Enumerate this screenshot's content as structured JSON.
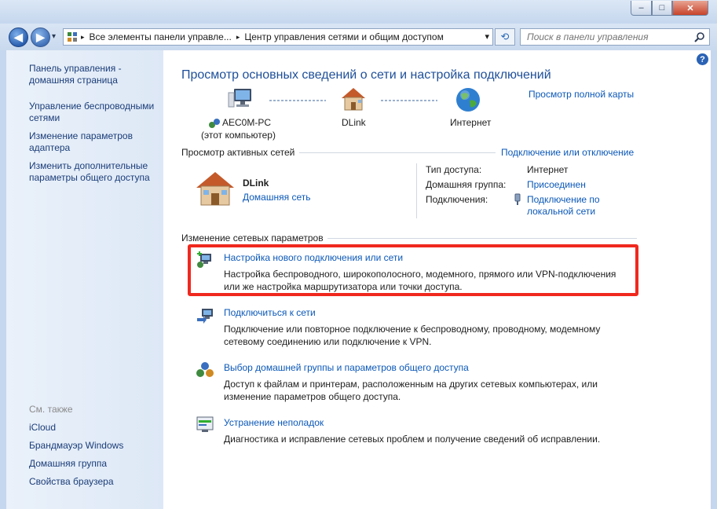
{
  "window": {
    "min_glyph": "–",
    "max_glyph": "□",
    "close_glyph": "✕"
  },
  "address": {
    "root_icon": "control-panel-icon",
    "crumb1": "Все элементы панели управле...",
    "sep": "▸",
    "crumb2": "Центр управления сетями и общим доступом",
    "dropdown_glyph": "▾",
    "refresh_glyph": "⟲"
  },
  "search": {
    "placeholder": "Поиск в панели управления"
  },
  "help_glyph": "?",
  "sidebar": {
    "home": "Панель управления - домашняя страница",
    "items": [
      "Управление беспроводными сетями",
      "Изменение параметров адаптера",
      "Изменить дополнительные параметры общего доступа"
    ],
    "see_also": "См. также",
    "see_also_items": [
      "iCloud",
      "Брандмауэр Windows",
      "Домашняя группа",
      "Свойства браузера"
    ]
  },
  "main": {
    "heading": "Просмотр основных сведений о сети и настройка подключений",
    "full_map": "Просмотр полной карты",
    "map": {
      "computer_name": "AEC0M-PC",
      "computer_sub": "(этот компьютер)",
      "network": "DLink",
      "internet": "Интернет"
    },
    "active_title": "Просмотр активных сетей",
    "connect_disconnect": "Подключение или отключение",
    "network_name": "DLink",
    "network_type": "Домашняя сеть",
    "props": {
      "access_label": "Тип доступа:",
      "access_value": "Интернет",
      "homegroup_label": "Домашняя группа:",
      "homegroup_value": "Присоединен",
      "connections_label": "Подключения:",
      "connections_value": "Подключение по локальной сети"
    },
    "change_title": "Изменение сетевых параметров",
    "tasks": [
      {
        "title": "Настройка нового подключения или сети",
        "desc": "Настройка беспроводного, широкополосного, модемного, прямого или VPN-подключения или же настройка маршрутизатора или точки доступа."
      },
      {
        "title": "Подключиться к сети",
        "desc": "Подключение или повторное подключение к беспроводному, проводному, модемному сетевому соединению или подключение к VPN."
      },
      {
        "title": "Выбор домашней группы и параметров общего доступа",
        "desc": "Доступ к файлам и принтерам, расположенным на других сетевых компьютерах, или изменение параметров общего доступа."
      },
      {
        "title": "Устранение неполадок",
        "desc": "Диагностика и исправление сетевых проблем и получение сведений об исправлении."
      }
    ]
  },
  "colors": {
    "link": "#0b58b8",
    "highlight": "#f0281e",
    "sidebar_bg": "#e3ecf8"
  }
}
